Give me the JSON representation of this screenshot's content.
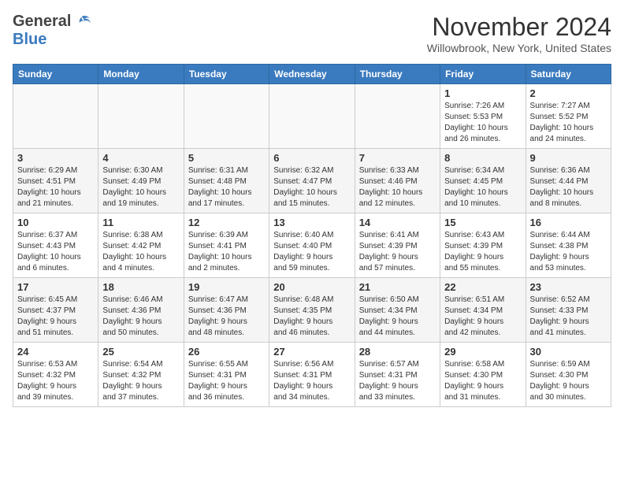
{
  "logo": {
    "general": "General",
    "blue": "Blue"
  },
  "header": {
    "month": "November 2024",
    "location": "Willowbrook, New York, United States"
  },
  "weekdays": [
    "Sunday",
    "Monday",
    "Tuesday",
    "Wednesday",
    "Thursday",
    "Friday",
    "Saturday"
  ],
  "weeks": [
    [
      {
        "day": "",
        "info": ""
      },
      {
        "day": "",
        "info": ""
      },
      {
        "day": "",
        "info": ""
      },
      {
        "day": "",
        "info": ""
      },
      {
        "day": "",
        "info": ""
      },
      {
        "day": "1",
        "info": "Sunrise: 7:26 AM\nSunset: 5:53 PM\nDaylight: 10 hours\nand 26 minutes."
      },
      {
        "day": "2",
        "info": "Sunrise: 7:27 AM\nSunset: 5:52 PM\nDaylight: 10 hours\nand 24 minutes."
      }
    ],
    [
      {
        "day": "3",
        "info": "Sunrise: 6:29 AM\nSunset: 4:51 PM\nDaylight: 10 hours\nand 21 minutes."
      },
      {
        "day": "4",
        "info": "Sunrise: 6:30 AM\nSunset: 4:49 PM\nDaylight: 10 hours\nand 19 minutes."
      },
      {
        "day": "5",
        "info": "Sunrise: 6:31 AM\nSunset: 4:48 PM\nDaylight: 10 hours\nand 17 minutes."
      },
      {
        "day": "6",
        "info": "Sunrise: 6:32 AM\nSunset: 4:47 PM\nDaylight: 10 hours\nand 15 minutes."
      },
      {
        "day": "7",
        "info": "Sunrise: 6:33 AM\nSunset: 4:46 PM\nDaylight: 10 hours\nand 12 minutes."
      },
      {
        "day": "8",
        "info": "Sunrise: 6:34 AM\nSunset: 4:45 PM\nDaylight: 10 hours\nand 10 minutes."
      },
      {
        "day": "9",
        "info": "Sunrise: 6:36 AM\nSunset: 4:44 PM\nDaylight: 10 hours\nand 8 minutes."
      }
    ],
    [
      {
        "day": "10",
        "info": "Sunrise: 6:37 AM\nSunset: 4:43 PM\nDaylight: 10 hours\nand 6 minutes."
      },
      {
        "day": "11",
        "info": "Sunrise: 6:38 AM\nSunset: 4:42 PM\nDaylight: 10 hours\nand 4 minutes."
      },
      {
        "day": "12",
        "info": "Sunrise: 6:39 AM\nSunset: 4:41 PM\nDaylight: 10 hours\nand 2 minutes."
      },
      {
        "day": "13",
        "info": "Sunrise: 6:40 AM\nSunset: 4:40 PM\nDaylight: 9 hours\nand 59 minutes."
      },
      {
        "day": "14",
        "info": "Sunrise: 6:41 AM\nSunset: 4:39 PM\nDaylight: 9 hours\nand 57 minutes."
      },
      {
        "day": "15",
        "info": "Sunrise: 6:43 AM\nSunset: 4:39 PM\nDaylight: 9 hours\nand 55 minutes."
      },
      {
        "day": "16",
        "info": "Sunrise: 6:44 AM\nSunset: 4:38 PM\nDaylight: 9 hours\nand 53 minutes."
      }
    ],
    [
      {
        "day": "17",
        "info": "Sunrise: 6:45 AM\nSunset: 4:37 PM\nDaylight: 9 hours\nand 51 minutes."
      },
      {
        "day": "18",
        "info": "Sunrise: 6:46 AM\nSunset: 4:36 PM\nDaylight: 9 hours\nand 50 minutes."
      },
      {
        "day": "19",
        "info": "Sunrise: 6:47 AM\nSunset: 4:36 PM\nDaylight: 9 hours\nand 48 minutes."
      },
      {
        "day": "20",
        "info": "Sunrise: 6:48 AM\nSunset: 4:35 PM\nDaylight: 9 hours\nand 46 minutes."
      },
      {
        "day": "21",
        "info": "Sunrise: 6:50 AM\nSunset: 4:34 PM\nDaylight: 9 hours\nand 44 minutes."
      },
      {
        "day": "22",
        "info": "Sunrise: 6:51 AM\nSunset: 4:34 PM\nDaylight: 9 hours\nand 42 minutes."
      },
      {
        "day": "23",
        "info": "Sunrise: 6:52 AM\nSunset: 4:33 PM\nDaylight: 9 hours\nand 41 minutes."
      }
    ],
    [
      {
        "day": "24",
        "info": "Sunrise: 6:53 AM\nSunset: 4:32 PM\nDaylight: 9 hours\nand 39 minutes."
      },
      {
        "day": "25",
        "info": "Sunrise: 6:54 AM\nSunset: 4:32 PM\nDaylight: 9 hours\nand 37 minutes."
      },
      {
        "day": "26",
        "info": "Sunrise: 6:55 AM\nSunset: 4:31 PM\nDaylight: 9 hours\nand 36 minutes."
      },
      {
        "day": "27",
        "info": "Sunrise: 6:56 AM\nSunset: 4:31 PM\nDaylight: 9 hours\nand 34 minutes."
      },
      {
        "day": "28",
        "info": "Sunrise: 6:57 AM\nSunset: 4:31 PM\nDaylight: 9 hours\nand 33 minutes."
      },
      {
        "day": "29",
        "info": "Sunrise: 6:58 AM\nSunset: 4:30 PM\nDaylight: 9 hours\nand 31 minutes."
      },
      {
        "day": "30",
        "info": "Sunrise: 6:59 AM\nSunset: 4:30 PM\nDaylight: 9 hours\nand 30 minutes."
      }
    ]
  ]
}
